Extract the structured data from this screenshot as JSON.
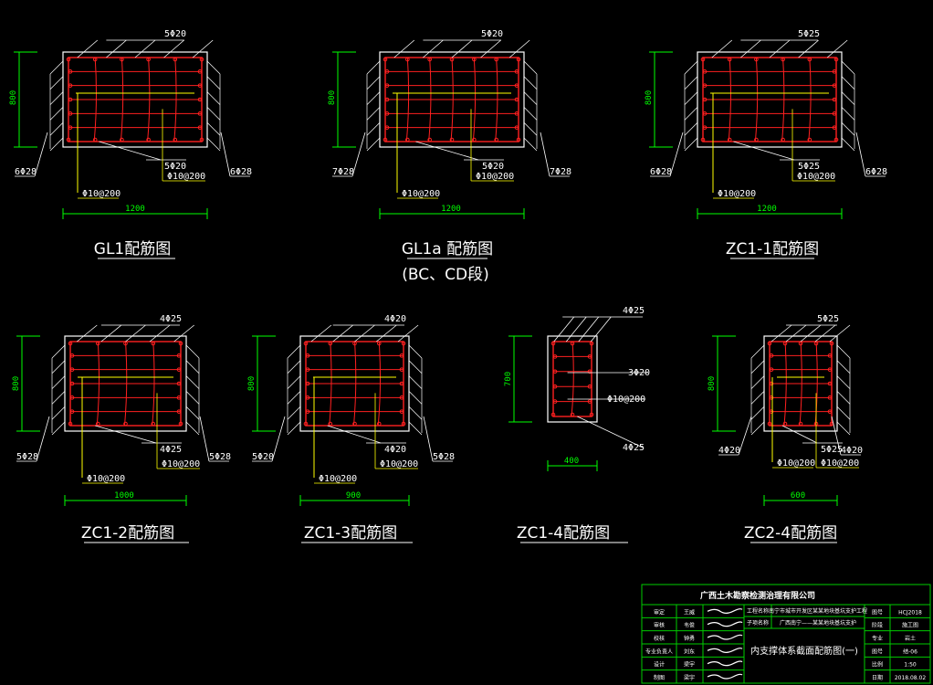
{
  "colors": {
    "background": "#000000",
    "outline": "#ffffff",
    "rebar": "#ff2020",
    "dimension": "#00ff00",
    "stirrup_hook": "#ffff00",
    "titleblock_frame": "#00cc00"
  },
  "sections": [
    {
      "id": "gl1",
      "title": "GL1配筋图",
      "height_dim": "800",
      "width_dim": "1200",
      "top_bars": "5Φ20",
      "side_left": "6Φ28",
      "side_right": "6Φ28",
      "bottom_bars": "5Φ20",
      "stirrup_a": "Φ10@200",
      "stirrup_b": "Φ10@200"
    },
    {
      "id": "gl1a",
      "title": "GL1a 配筋图",
      "subtitle": "(BC、CD段)",
      "height_dim": "800",
      "width_dim": "1200",
      "top_bars": "5Φ20",
      "side_left": "7Φ28",
      "side_right": "7Φ28",
      "bottom_bars": "5Φ20",
      "stirrup_a": "Φ10@200",
      "stirrup_b": "Φ10@200"
    },
    {
      "id": "zc1-1",
      "title": "ZC1-1配筋图",
      "height_dim": "800",
      "width_dim": "1200",
      "top_bars": "5Φ25",
      "side_left": "6Φ28",
      "side_right": "6Φ28",
      "bottom_bars": "5Φ25",
      "stirrup_a": "Φ10@200",
      "stirrup_b": "Φ10@200"
    },
    {
      "id": "zc1-2",
      "title": "ZC1-2配筋图",
      "height_dim": "800",
      "width_dim": "1000",
      "top_bars": "4Φ25",
      "side_left": "5Φ28",
      "side_right": "5Φ28",
      "bottom_bars": "4Φ25",
      "stirrup_a": "Φ10@200",
      "stirrup_b": "Φ10@200"
    },
    {
      "id": "zc1-3",
      "title": "ZC1-3配筋图",
      "height_dim": "800",
      "width_dim": "900",
      "top_bars": "4Φ20",
      "side_left": "5Φ20",
      "side_right": "5Φ28",
      "bottom_bars": "4Φ20",
      "stirrup_a": "Φ10@200",
      "stirrup_b": "Φ10@200"
    },
    {
      "id": "zc1-4",
      "title": "ZC1-4配筋图",
      "height_dim": "700",
      "width_dim": "400",
      "top_bars": "4Φ25",
      "mid_bars": "3Φ20",
      "stirrup_a": "Φ10@200",
      "bottom_bars": "4Φ25"
    },
    {
      "id": "zc2-4",
      "title": "ZC2-4配筋图",
      "height_dim": "800",
      "width_dim": "600",
      "top_bars": "5Φ25",
      "side_left": "4Φ20",
      "side_right": "4Φ20",
      "bottom_bars": "5Φ25",
      "stirrup_a": "Φ10@200",
      "stirrup_b": "Φ10@200"
    }
  ],
  "title_block": {
    "company": "广西土木勘察检测治理有限公司",
    "drawing_name": "内支撑体系截面配筋图(一)",
    "roles": [
      "审定",
      "审核",
      "校核",
      "专业负责人",
      "设计",
      "制图"
    ],
    "names": [
      "王威",
      "韦俊",
      "钟勇",
      "刘东",
      "梁宇",
      "梁宇"
    ],
    "project_label": "工程名称",
    "project_value": "南宁市城市开发区某某地块基坑支护工程",
    "subproject_label": "子项名称",
    "subproject_value": "广西南宁——某某地块基坑支护",
    "right_labels": [
      "图号",
      "阶段",
      "专业",
      "图号",
      "比例",
      "日期"
    ],
    "right_values": [
      "HCJ2018",
      "施工图",
      "岩土",
      "结-06",
      "1:50",
      "2018.08.02"
    ]
  }
}
